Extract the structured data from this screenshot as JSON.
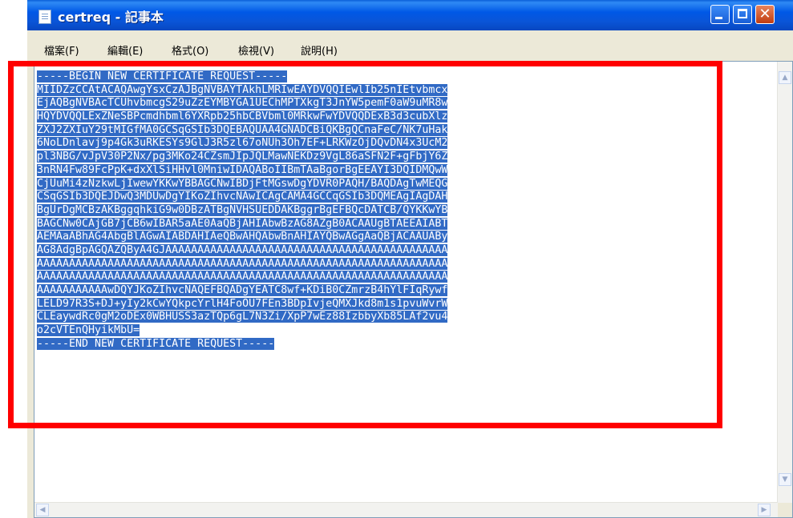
{
  "window": {
    "title": "certreq - 記事本",
    "icon": "notepad-icon"
  },
  "menu": {
    "items": [
      "檔案(F)",
      "編輯(E)",
      "格式(O)",
      "檢視(V)",
      "說明(H)"
    ]
  },
  "document": {
    "lines": [
      "-----BEGIN NEW CERTIFICATE REQUEST-----",
      "MIIDZzCCAtACAQAwgYsxCzAJBgNVBAYTAkhLMRIwEAYDVQQIEwlIb25nIEtvbmcx",
      "EjAQBgNVBAcTCUhvbmcgS29uZzEYMBYGA1UEChMPTXkgT3JnYW5pemF0aW9uMR8w",
      "HQYDVQQLExZNeSBPcmdhbml6YXRpb25hbCBVbml0MRkwFwYDVQQDExB3d3cubXlz",
      "ZXJ2ZXIuY29tMIGfMA0GCSqGSIb3DQEBAQUAA4GNADCBiQKBgQCnaFeC/NK7uHak",
      "6NoLDnlavj9p4Gk3uRKESYs9GlJ3R5zl67oNUh3Oh7EF+LRKWzOjDQvDN4x3UcM2",
      "pl3NBG/vJpV30P2Nx/pg3MKo24CZsmJIpJQLMawNEKDz9VgL86aSFN2F+gFbjY6Z",
      "3nRN4Fw89FcPpK+dxXlSiHHvl0MniwIDAQABoIIBmTAaBgorBgEEAYI3DQIDMQwW",
      "CjUuMi4zNzkwLjIwewYKKwYBBAGCNwIBDjFtMGswDgYDVR0PAQH/BAQDAgTwMEQG",
      "CSqGSIb3DQEJDwQ3MDUwDgYIKoZIhvcNAwICAgCAMA4GCCqGSIb3DQMEAgIAgDAH",
      "BgUrDgMCBzAKBggqhkiG9w0DBzATBgNVHSUEDDAKBggrBgEFBQcDATCB/QYKKwYB",
      "BAGCNw0CAjGB7jCB6wIBAR5aAE0AaQBjAHIAbwBzAG8AZgB0ACAAUgBTAEEAIABT",
      "AEMAaABhAG4AbgBlAGwAIABDAHIAeQBwAHQAbwBnAHIAYQBwAGgAaQBjACAAUABy",
      "AG8AdgBpAGQAZQByA4GJAAAAAAAAAAAAAAAAAAAAAAAAAAAAAAAAAAAAAAAAAAAA",
      "AAAAAAAAAAAAAAAAAAAAAAAAAAAAAAAAAAAAAAAAAAAAAAAAAAAAAAAAAAAAAAAA",
      "AAAAAAAAAAAAAAAAAAAAAAAAAAAAAAAAAAAAAAAAAAAAAAAAAAAAAAAAAAAAAAAA",
      "AAAAAAAAAAAwDQYJKoZIhvcNAQEFBQADgYEATC8wf+KDiB0CZmrzB4hYlFIqRywf",
      "LELD97R3S+DJ+yIy2kCwYQkpcYrlH4FoOU7FEn3BDpIvjeQMXJkd8m1s1pvuWvrW",
      "CLEaywdRc0gM2oDEx0WBHUSS3azTQp6gL7N3Zi/XpP7wEz88IzbbyXb85LAf2vu4",
      "o2cVTEnQHyikMbU=",
      "-----END NEW CERTIFICATE REQUEST-----"
    ]
  },
  "annotation": {
    "color": "#ff0000"
  },
  "colors": {
    "selection": "#316ac5",
    "titlebar": "#0a55d8"
  }
}
